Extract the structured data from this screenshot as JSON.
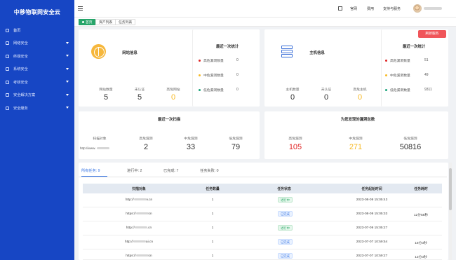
{
  "app": {
    "brand": "中移物联网安全云"
  },
  "sidebar": {
    "items": [
      {
        "label": "首页",
        "expandable": false
      },
      {
        "label": "网络安全",
        "expandable": true
      },
      {
        "label": "终端安全",
        "expandable": true
      },
      {
        "label": "系统安全",
        "expandable": true
      },
      {
        "label": "考核安全",
        "expandable": true
      },
      {
        "label": "安全解决方案",
        "expandable": true
      },
      {
        "label": "安全服务",
        "expandable": true
      }
    ]
  },
  "topbar": {
    "links": [
      "官网",
      "费用",
      "支持与服务"
    ]
  },
  "tabs": [
    "首页",
    "资产列表",
    "任务列表"
  ],
  "site_info": {
    "title": "网站信息",
    "latest_stats_title": "最近一次统计",
    "counts": [
      {
        "label": "网站数量",
        "value": "5"
      },
      {
        "label": "未认证",
        "value": "5"
      },
      {
        "label": "高危网站",
        "value": "0"
      }
    ],
    "vulns": [
      {
        "label": "高危漏洞数量",
        "value": "0",
        "color": "#e02424"
      },
      {
        "label": "中危漏洞数量",
        "value": "0",
        "color": "#f7b924"
      },
      {
        "label": "低危漏洞数量",
        "value": "0",
        "color": "#1aa37a"
      }
    ]
  },
  "host_info": {
    "title": "主机信息",
    "latest_stats_title": "最近一次统计",
    "refresh_label": "刷新服务",
    "counts": [
      {
        "label": "主机数量",
        "value": "0"
      },
      {
        "label": "未认证",
        "value": "0"
      },
      {
        "label": "高危主机",
        "value": "0"
      }
    ],
    "vulns": [
      {
        "label": "高危漏洞数量",
        "value": "51",
        "color": "#e02424"
      },
      {
        "label": "中危漏洞数量",
        "value": "49",
        "color": "#f7b924"
      },
      {
        "label": "低危漏洞数量",
        "value": "9311",
        "color": "#1aa37a"
      }
    ]
  },
  "last_scan": {
    "title": "最近一次扫描",
    "headers": [
      "扫描对象",
      "高危漏洞",
      "中危漏洞",
      "低危漏洞"
    ],
    "target": "http://www.",
    "high": "2",
    "medium": "33",
    "low": "79"
  },
  "found_vulns": {
    "title": "为您发现的漏洞总数",
    "headers": [
      "高危漏洞",
      "中危漏洞",
      "低危漏洞"
    ],
    "high": "105",
    "medium": "271",
    "low": "50816"
  },
  "tasks": {
    "tabs": [
      "所有任务: 9",
      "进行中: 2",
      "已完成: 7",
      "任务失败: 0"
    ],
    "columns": [
      "扫描对象",
      "任务数量",
      "任务状态",
      "任务起始时间",
      "任务耗时"
    ],
    "rows": [
      {
        "target_prefix": "http://",
        "target_suffix": "v.cn",
        "count": "1",
        "status": "进行中",
        "status_type": "running",
        "start": "2023-08-09 15:05:43",
        "duration": ""
      },
      {
        "target_prefix": "https://",
        "target_suffix": "cn",
        "count": "1",
        "status": "已完成",
        "status_type": "done",
        "start": "2023-08-09 15:05:33",
        "duration": "12分58秒"
      },
      {
        "target_prefix": "http://",
        "target_suffix": ".cn",
        "count": "1",
        "status": "进行中",
        "status_type": "running",
        "start": "2023-07-09 15:05:27",
        "duration": ""
      },
      {
        "target_prefix": "http://",
        "target_suffix": "ai.cn",
        "count": "1",
        "status": "已完成",
        "status_type": "done",
        "start": "2023-07-07 10:59:54",
        "duration": "18分3秒"
      },
      {
        "target_prefix": "https://",
        "target_suffix": "cn",
        "count": "1",
        "status": "已完成",
        "status_type": "done",
        "start": "2023-07-07 10:59:27",
        "duration": "13分3秒"
      }
    ]
  }
}
